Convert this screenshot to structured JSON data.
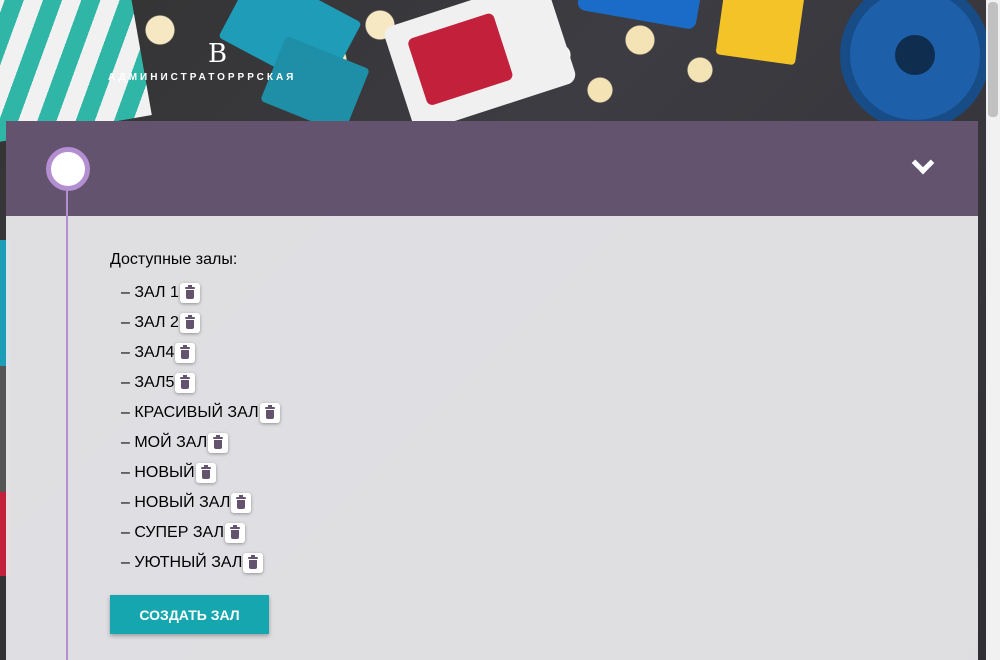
{
  "logo": {
    "mark": "B",
    "text": "АДМИНИСТРАТОРРРСКАЯ"
  },
  "icons": {
    "toggle": "chevron-down-icon",
    "delete": "trash-icon"
  },
  "colors": {
    "header": "#63536f",
    "accent_line": "#b38fd2",
    "create_button": "#16a6af",
    "trash_icon": "#63536f"
  },
  "halls": {
    "title": "Доступные залы:",
    "items": [
      {
        "label": "– ЗАЛ 1"
      },
      {
        "label": "– ЗАЛ 2"
      },
      {
        "label": "– ЗАЛ4"
      },
      {
        "label": "– ЗАЛ5"
      },
      {
        "label": "– КРАСИВЫЙ ЗАЛ"
      },
      {
        "label": "– МОЙ ЗАЛ"
      },
      {
        "label": "– НОВЫЙ"
      },
      {
        "label": "– НОВЫЙ ЗАЛ"
      },
      {
        "label": "– СУПЕР ЗАЛ"
      },
      {
        "label": "– УЮТНЫЙ ЗАЛ"
      }
    ],
    "create_label": "СОЗДАТЬ ЗАЛ"
  }
}
